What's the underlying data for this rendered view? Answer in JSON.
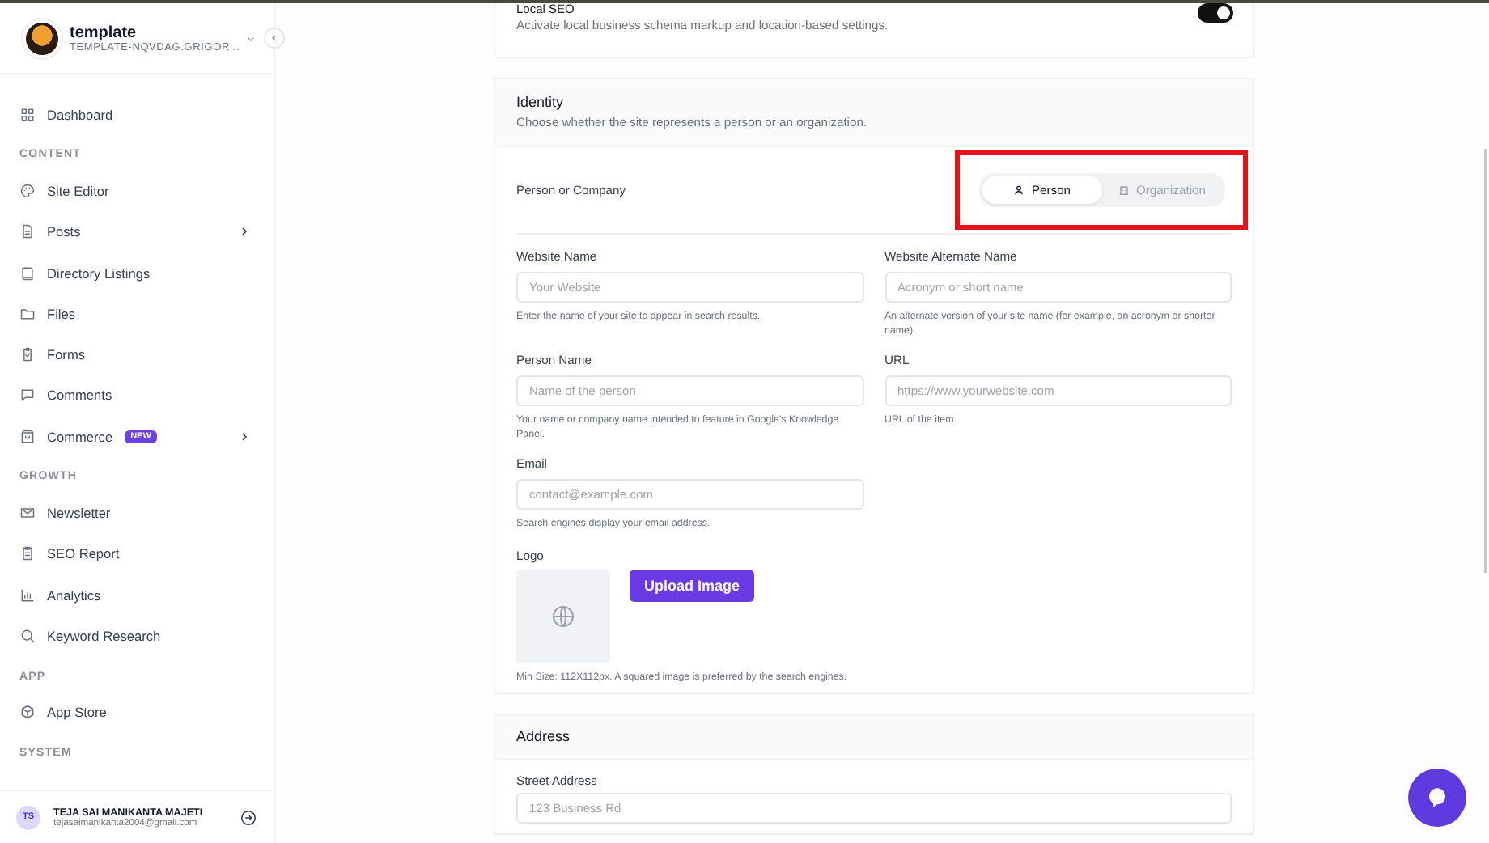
{
  "site": {
    "name": "template",
    "domain": "TEMPLATE-NQVDAG.GRIGOR..."
  },
  "sidebar": {
    "sections": [
      {
        "items": [
          {
            "label": "Dashboard",
            "has_submenu": false
          }
        ]
      },
      {
        "title": "CONTENT",
        "items": [
          {
            "label": "Site Editor",
            "has_submenu": false
          },
          {
            "label": "Posts",
            "has_submenu": true
          },
          {
            "label": "Directory Listings",
            "has_submenu": false
          },
          {
            "label": "Files",
            "has_submenu": false
          },
          {
            "label": "Forms",
            "has_submenu": false
          },
          {
            "label": "Comments",
            "has_submenu": false
          },
          {
            "label": "Commerce",
            "badge": "NEW",
            "has_submenu": true
          }
        ]
      },
      {
        "title": "GROWTH",
        "items": [
          {
            "label": "Newsletter",
            "has_submenu": false
          },
          {
            "label": "SEO Report",
            "has_submenu": false
          },
          {
            "label": "Analytics",
            "has_submenu": false
          },
          {
            "label": "Keyword Research",
            "has_submenu": false
          }
        ]
      },
      {
        "title": "APP",
        "items": [
          {
            "label": "App Store",
            "has_submenu": false
          }
        ]
      },
      {
        "title": "SYSTEM"
      }
    ]
  },
  "user": {
    "initials": "TS",
    "name": "TEJA SAI MANIKANTA MAJETI",
    "email": "tejasaimanikanta2004@gmail.com"
  },
  "local_seo": {
    "title": "Local SEO",
    "description": "Activate local business schema markup and location-based settings.",
    "on": true
  },
  "identity": {
    "title": "Identity",
    "description": "Choose whether the site represents a person or an organization.",
    "type_label": "Person or Company",
    "type_options": [
      {
        "label": "Person",
        "selected": true
      },
      {
        "label": "Organization",
        "selected": false
      }
    ],
    "fields": [
      {
        "label": "Website Name",
        "placeholder": "Your Website",
        "help": "Enter the name of your site to appear in search results."
      },
      {
        "label": "Website Alternate Name",
        "placeholder": "Acronym or short name",
        "help": "An alternate version of your site name (for example, an acronym or shorter name)."
      },
      {
        "label": "Person Name",
        "placeholder": "Name of the person",
        "help": "Your name or company name intended to feature in Google's Knowledge Panel."
      },
      {
        "label": "URL",
        "placeholder": "https://www.yourwebsite.com",
        "help": "URL of the item."
      },
      {
        "label": "Email",
        "placeholder": "contact@example.com",
        "help": "Search engines display your email address."
      }
    ],
    "logo": {
      "label": "Logo",
      "button": "Upload Image",
      "help": "Min Size: 112X112px. A squared image is preferred by the search engines."
    }
  },
  "address": {
    "title": "Address",
    "fields": [
      {
        "label": "Street Address",
        "placeholder": "123 Business Rd"
      }
    ]
  }
}
